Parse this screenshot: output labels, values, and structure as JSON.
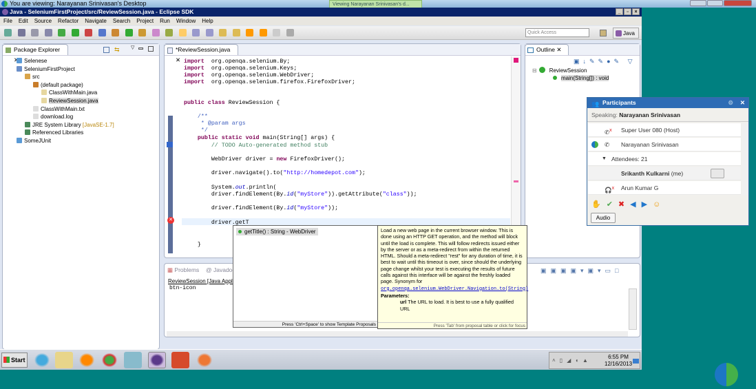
{
  "viewer": {
    "title": "You are viewing: Narayanan Srinivasan's Desktop",
    "badge": "Viewing Narayanan Srinivasan's d..."
  },
  "window": {
    "title": "Java - SeleniumFirstProject/src/ReviewSession.java - Eclipse SDK",
    "min": "_",
    "max": "▫",
    "close": "×"
  },
  "menu": [
    "File",
    "Edit",
    "Source",
    "Refactor",
    "Navigate",
    "Search",
    "Project",
    "Run",
    "Window",
    "Help"
  ],
  "toolbar": {
    "quick_access_placeholder": "Quick Access",
    "perspective": "Java"
  },
  "package_explorer": {
    "tab": "Package Explorer",
    "tree": [
      {
        "label": "Selenese",
        "depth": 0,
        "icon": "folder"
      },
      {
        "label": "SeleniumFirstProject",
        "depth": 0,
        "icon": "project"
      },
      {
        "label": "src",
        "depth": 1,
        "icon": "package-folder"
      },
      {
        "label": "(default package)",
        "depth": 2,
        "icon": "package"
      },
      {
        "label": "ClassWithMain.java",
        "depth": 3,
        "icon": "java-file"
      },
      {
        "label": "ReviewSession.java",
        "depth": 3,
        "icon": "java-file",
        "selected": true
      },
      {
        "label": "ClassWithMain.txt",
        "depth": 2,
        "icon": "text-file"
      },
      {
        "label": "download.log",
        "depth": 2,
        "icon": "text-file"
      },
      {
        "label": "JRE System Library",
        "suffix": "[JavaSE-1.7]",
        "depth": 1,
        "icon": "library"
      },
      {
        "label": "Referenced Libraries",
        "depth": 1,
        "icon": "library"
      },
      {
        "label": "SomeJUnit",
        "depth": 0,
        "icon": "folder"
      }
    ]
  },
  "editor": {
    "tab": "*ReviewSession.java",
    "lines": [
      [
        [
          "kw",
          "import"
        ],
        [
          "",
          "  org.openqa.selenium.By;"
        ]
      ],
      [
        [
          "kw",
          "import"
        ],
        [
          "",
          "  org.openqa.selenium.Keys;"
        ]
      ],
      [
        [
          "kw",
          "import"
        ],
        [
          "",
          "  org.openqa.selenium.WebDriver;"
        ]
      ],
      [
        [
          "kw",
          "import"
        ],
        [
          "",
          "  org.openqa.selenium.firefox.FirefoxDriver;"
        ]
      ],
      [
        [
          "kw",
          "public class"
        ],
        [
          "",
          " ReviewSession {"
        ]
      ],
      [
        [
          "jd",
          "    /**"
        ]
      ],
      [
        [
          "jd",
          "     * @param args"
        ]
      ],
      [
        [
          "jd",
          "     */"
        ]
      ],
      [
        [
          "kw",
          "    public static void"
        ],
        [
          "",
          " main(String[] args) {"
        ]
      ],
      [
        [
          "cm",
          "        // TODO Auto-generated method stub"
        ]
      ],
      [
        [
          "",
          "        WebDriver driver = "
        ],
        [
          "kw",
          "new"
        ],
        [
          "",
          " FirefoxDriver();"
        ]
      ],
      [
        [
          "",
          "        driver.navigate().to("
        ],
        [
          "st",
          "\"http://homedepot.com\""
        ],
        [
          "",
          ");"
        ]
      ],
      [
        [
          "",
          "        System."
        ],
        [
          "it",
          "out"
        ],
        [
          "",
          ".println("
        ]
      ],
      [
        [
          "",
          "        driver.findElement(By."
        ],
        [
          "it",
          "id"
        ],
        [
          "",
          "("
        ],
        [
          "st",
          "\"myStore\""
        ],
        [
          "",
          "))."
        ],
        [
          "",
          "getAttribute("
        ],
        [
          "st",
          "\"class\""
        ],
        [
          "",
          "));"
        ]
      ],
      [
        [
          "",
          "        driver.findElement(By."
        ],
        [
          "it",
          "id"
        ],
        [
          "",
          "("
        ],
        [
          "st",
          "\"myStore\""
        ],
        [
          "",
          "));"
        ]
      ],
      [
        [
          "",
          "        driver.getT"
        ]
      ],
      [
        [
          "",
          "    }"
        ]
      ]
    ]
  },
  "autocomplete": {
    "item": "getTitle() : String - WebDriver",
    "footer": "Press 'Ctrl+Space' to show Template Proposals"
  },
  "javadoc": {
    "text": "Load a new web page in the current browser window. This is done using an HTTP GET operation, and the method will block until the load is complete. This will follow redirects issued either by the server or as a meta-redirect from within the returned HTML. Should a meta-redirect \"rest\" for any duration of time, it is best to wait until this timeout is over, since should the underlying page change whilst your test is executing the results of future calls against this interface will be against the freshly loaded page. Synonym for",
    "link": "org.openqa.selenium.WebDriver.Navigation.to(String)",
    "params_label": "Parameters:",
    "param_name": "url",
    "param_desc": "The URL to load. It is best to use a fully qualified URL",
    "footer": "Press 'Tab' from proposal table or click for focus"
  },
  "outline": {
    "tab": "Outline",
    "class": "ReviewSession",
    "method": "main(String[]) : void"
  },
  "bottom": {
    "tabs": [
      "Problems",
      "Javadoc"
    ],
    "console_title": "ReviewSession [Java Applica",
    "console_text": "btn-icon"
  },
  "taskbar": {
    "start": "Start",
    "time": "6:55 PM",
    "date": "12/16/2013"
  },
  "participants": {
    "title": "Participants",
    "speaking_label": "Speaking:",
    "speaking_name": "Narayanan Srinivasan",
    "rows": [
      {
        "name": "Super User 080 (Host)"
      },
      {
        "name": "Narayanan Srinivasan"
      },
      {
        "name": "Attendees: 21"
      },
      {
        "name": "Srikanth Kulkarni",
        "suffix": "(me)"
      },
      {
        "name": "Arun Kumar G"
      }
    ],
    "audio_button": "Audio"
  }
}
